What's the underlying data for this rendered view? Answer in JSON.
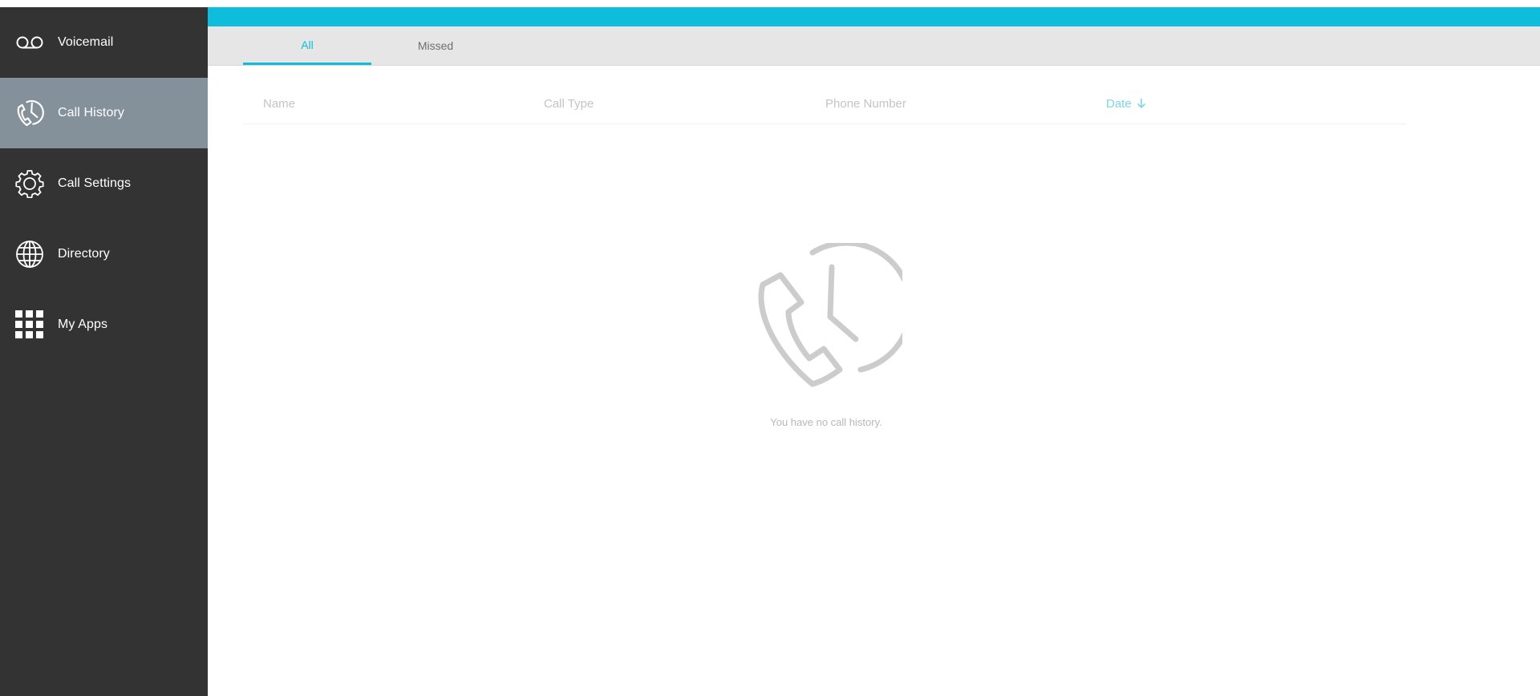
{
  "sidebar": {
    "items": [
      {
        "label": "Voicemail",
        "icon": "voicemail-icon"
      },
      {
        "label": "Call History",
        "icon": "call-history-icon",
        "active": true
      },
      {
        "label": "Call Settings",
        "icon": "gear-icon"
      },
      {
        "label": "Directory",
        "icon": "globe-icon"
      },
      {
        "label": "My Apps",
        "icon": "apps-grid-icon"
      }
    ]
  },
  "tabs": [
    {
      "label": "All",
      "active": true
    },
    {
      "label": "Missed",
      "active": false
    }
  ],
  "table": {
    "columns": [
      {
        "label": "Name"
      },
      {
        "label": "Call Type"
      },
      {
        "label": "Phone Number"
      },
      {
        "label": "Date",
        "sorted": "desc"
      }
    ]
  },
  "empty_state": {
    "message": "You have no call history.",
    "icon": "call-history-icon"
  },
  "colors": {
    "accent": "#0ebcdb",
    "sidebar_bg": "#333333",
    "sidebar_active": "#84919b"
  }
}
